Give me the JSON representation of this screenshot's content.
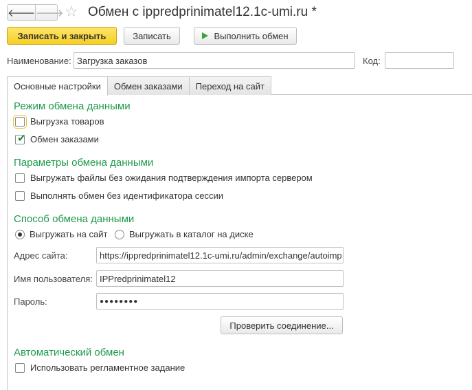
{
  "window": {
    "title": "Обмен с ippredprinimatel12.1c-umi.ru *",
    "nav_back": "🡐",
    "nav_forward": "🡒",
    "star": "☆"
  },
  "toolbar": {
    "save_close_label": "Записать и закрыть",
    "save_label": "Записать",
    "run_label": "Выполнить обмен"
  },
  "header": {
    "name_label": "Наименование:",
    "name_value": "Загрузка заказов",
    "code_label": "Код:",
    "code_value": ""
  },
  "tabs": [
    {
      "label": "Основные настройки",
      "active": true
    },
    {
      "label": "Обмен заказами",
      "active": false
    },
    {
      "label": "Переход на сайт",
      "active": false
    }
  ],
  "mode": {
    "title": "Режим обмена данными",
    "export_goods": {
      "label": "Выгрузка товаров",
      "checked": false
    },
    "order_exchange": {
      "label": "Обмен заказами",
      "checked": true
    }
  },
  "params": {
    "title": "Параметры обмена данными",
    "no_wait": {
      "label": "Выгружать файлы без ожидания подтверждения импорта сервером",
      "checked": false
    },
    "no_session": {
      "label": "Выполнять обмен без идентификатора сессии",
      "checked": false
    }
  },
  "method": {
    "title": "Способ обмена данными",
    "to_site": {
      "label": "Выгружать на сайт",
      "selected": true
    },
    "to_disk": {
      "label": "Выгружать в каталог на диске",
      "selected": false
    },
    "address_label": "Адрес сайта:",
    "address_value": "https://ippredprinimatel12.1c-umi.ru/admin/exchange/autoimp",
    "user_label": "Имя пользователя:",
    "user_value": "IPPredprinimatel12",
    "password_label": "Пароль:",
    "password_value": "●●●●●●●●",
    "check_button": "Проверить соединение..."
  },
  "auto": {
    "title": "Автоматический обмен",
    "scheduled": {
      "label": "Использовать регламентное задание",
      "checked": false
    }
  },
  "colors": {
    "section_green": "#1e9a4b",
    "primary_yellow": "#f5cf23",
    "run_icon_green": "#3aa23a"
  }
}
